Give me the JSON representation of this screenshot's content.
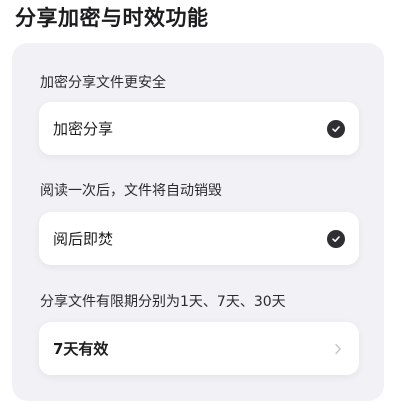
{
  "page": {
    "title": "分享加密与时效功能"
  },
  "sections": [
    {
      "label": "加密分享文件更安全",
      "option": "加密分享"
    },
    {
      "label": "阅读一次后，文件将自动销毁",
      "option": "阅后即焚"
    },
    {
      "label": "分享文件有限期分别为1天、7天、30天",
      "option": "7天有效"
    }
  ],
  "icons": {
    "check": "check-circle-icon",
    "chevron": "chevron-right-icon"
  },
  "colors": {
    "panel_bg": "#f1f1f6",
    "check_bg": "#2f2f33"
  }
}
